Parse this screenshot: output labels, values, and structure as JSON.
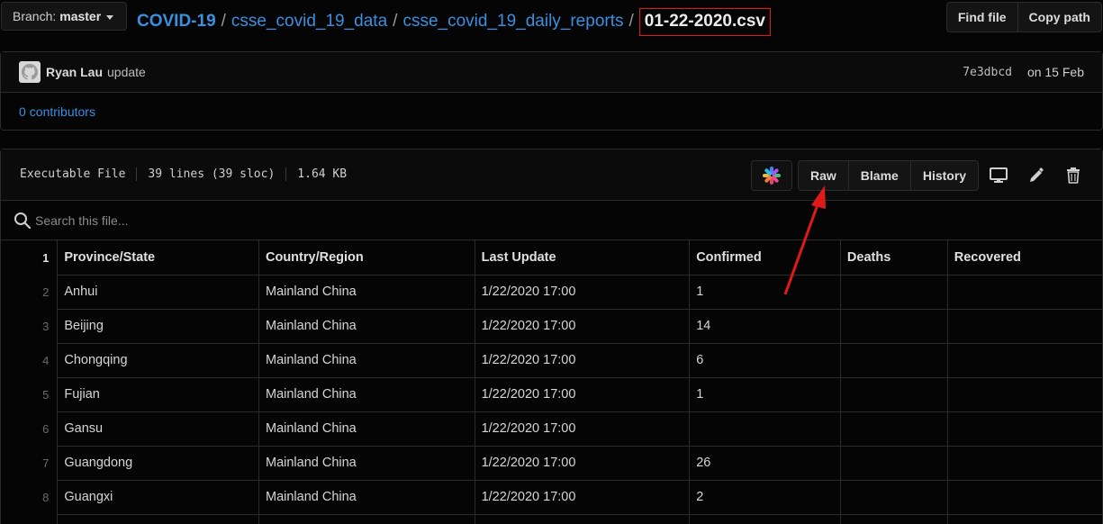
{
  "branch": {
    "label": "Branch:",
    "name": "master"
  },
  "breadcrumb": {
    "repo": "COVID-19",
    "parts": [
      "csse_covid_19_data",
      "csse_covid_19_daily_reports"
    ],
    "file": "01-22-2020.csv",
    "separator": "/"
  },
  "top_actions": {
    "find_file": "Find file",
    "copy_path": "Copy path"
  },
  "commit": {
    "author": "Ryan Lau",
    "message": "update",
    "sha": "7e3dbcd",
    "date": "on 15 Feb",
    "contributors_count": "0",
    "contributors_label": "contributors"
  },
  "file": {
    "mode": "Executable File",
    "lines": "39 lines (39 sloc)",
    "size": "1.64 KB",
    "raw_label": "Raw",
    "blame_label": "Blame",
    "history_label": "History",
    "search_placeholder": "Search this file..."
  },
  "table": {
    "headers": [
      "Province/State",
      "Country/Region",
      "Last Update",
      "Confirmed",
      "Deaths",
      "Recovered"
    ],
    "rows": [
      {
        "line": "2",
        "cells": [
          "Anhui",
          "Mainland China",
          "1/22/2020 17:00",
          "1",
          "",
          ""
        ]
      },
      {
        "line": "3",
        "cells": [
          "Beijing",
          "Mainland China",
          "1/22/2020 17:00",
          "14",
          "",
          ""
        ]
      },
      {
        "line": "4",
        "cells": [
          "Chongqing",
          "Mainland China",
          "1/22/2020 17:00",
          "6",
          "",
          ""
        ]
      },
      {
        "line": "5",
        "cells": [
          "Fujian",
          "Mainland China",
          "1/22/2020 17:00",
          "1",
          "",
          ""
        ]
      },
      {
        "line": "6",
        "cells": [
          "Gansu",
          "Mainland China",
          "1/22/2020 17:00",
          "",
          "",
          ""
        ]
      },
      {
        "line": "7",
        "cells": [
          "Guangdong",
          "Mainland China",
          "1/22/2020 17:00",
          "26",
          "",
          ""
        ]
      },
      {
        "line": "8",
        "cells": [
          "Guangxi",
          "Mainland China",
          "1/22/2020 17:00",
          "2",
          "",
          ""
        ]
      },
      {
        "line": "9",
        "cells": [
          "",
          "",
          "",
          "",
          "",
          ""
        ]
      }
    ],
    "header_line": "1"
  },
  "colors": {
    "accent": "#3b8fe0",
    "highlight": "#e0191b",
    "background": "#050505"
  }
}
